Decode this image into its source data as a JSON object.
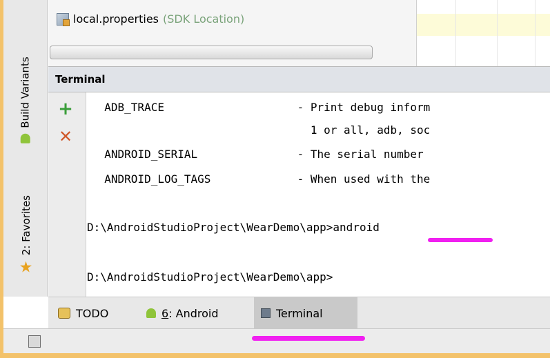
{
  "window": {
    "project": {
      "file_name": "local.properties",
      "file_hint": "(SDK Location)"
    },
    "left_tabs": [
      {
        "label": "Build Variants",
        "icon": "android-icon"
      },
      {
        "label": "2: Favorites",
        "icon": "star-icon"
      }
    ],
    "terminal": {
      "title": "Terminal",
      "toolbar": {
        "add_label": "+",
        "close_label": "✕"
      },
      "lines": [
        "  ADB_TRACE                    - Print debug inform",
        "                                 1 or all, adb, soc",
        "  ANDROID_SERIAL               - The serial number",
        "  ANDROID_LOG_TAGS             - When used with the",
        "",
        "D:\\AndroidStudioProject\\WearDemo\\app>android",
        "",
        "D:\\AndroidStudioProject\\WearDemo\\app>"
      ]
    },
    "bottom_tabs": [
      {
        "label": "TODO",
        "icon": "todo-icon"
      },
      {
        "num": "6",
        "rest": ": Android",
        "icon": "android-icon"
      },
      {
        "label": "Terminal",
        "icon": "terminal-icon",
        "active": true
      }
    ],
    "colors": {
      "frame": "#f3c26a",
      "highlight": "#f020f0",
      "add": "#3a9e3a",
      "close": "#d05a2c"
    }
  }
}
